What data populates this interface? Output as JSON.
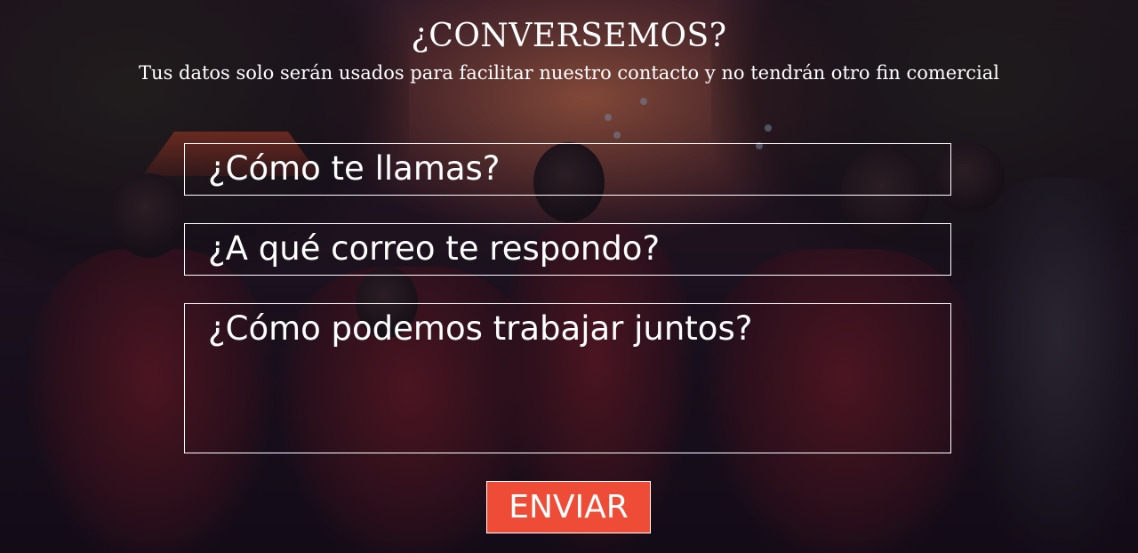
{
  "header": {
    "title": "¿CONVERSEMOS?",
    "subtitle": "Tus datos solo serán usados para facilitar nuestro contacto y no tendrán otro fin comercial"
  },
  "form": {
    "name_placeholder": "¿Cómo te llamas?",
    "email_placeholder": "¿A qué correo te respondo?",
    "message_placeholder": "¿Cómo podemos trabajar juntos?",
    "submit_label": "ENVIAR"
  },
  "colors": {
    "button_background": "#ee4c36",
    "text": "#ffffff",
    "field_border": "#ffffff"
  }
}
